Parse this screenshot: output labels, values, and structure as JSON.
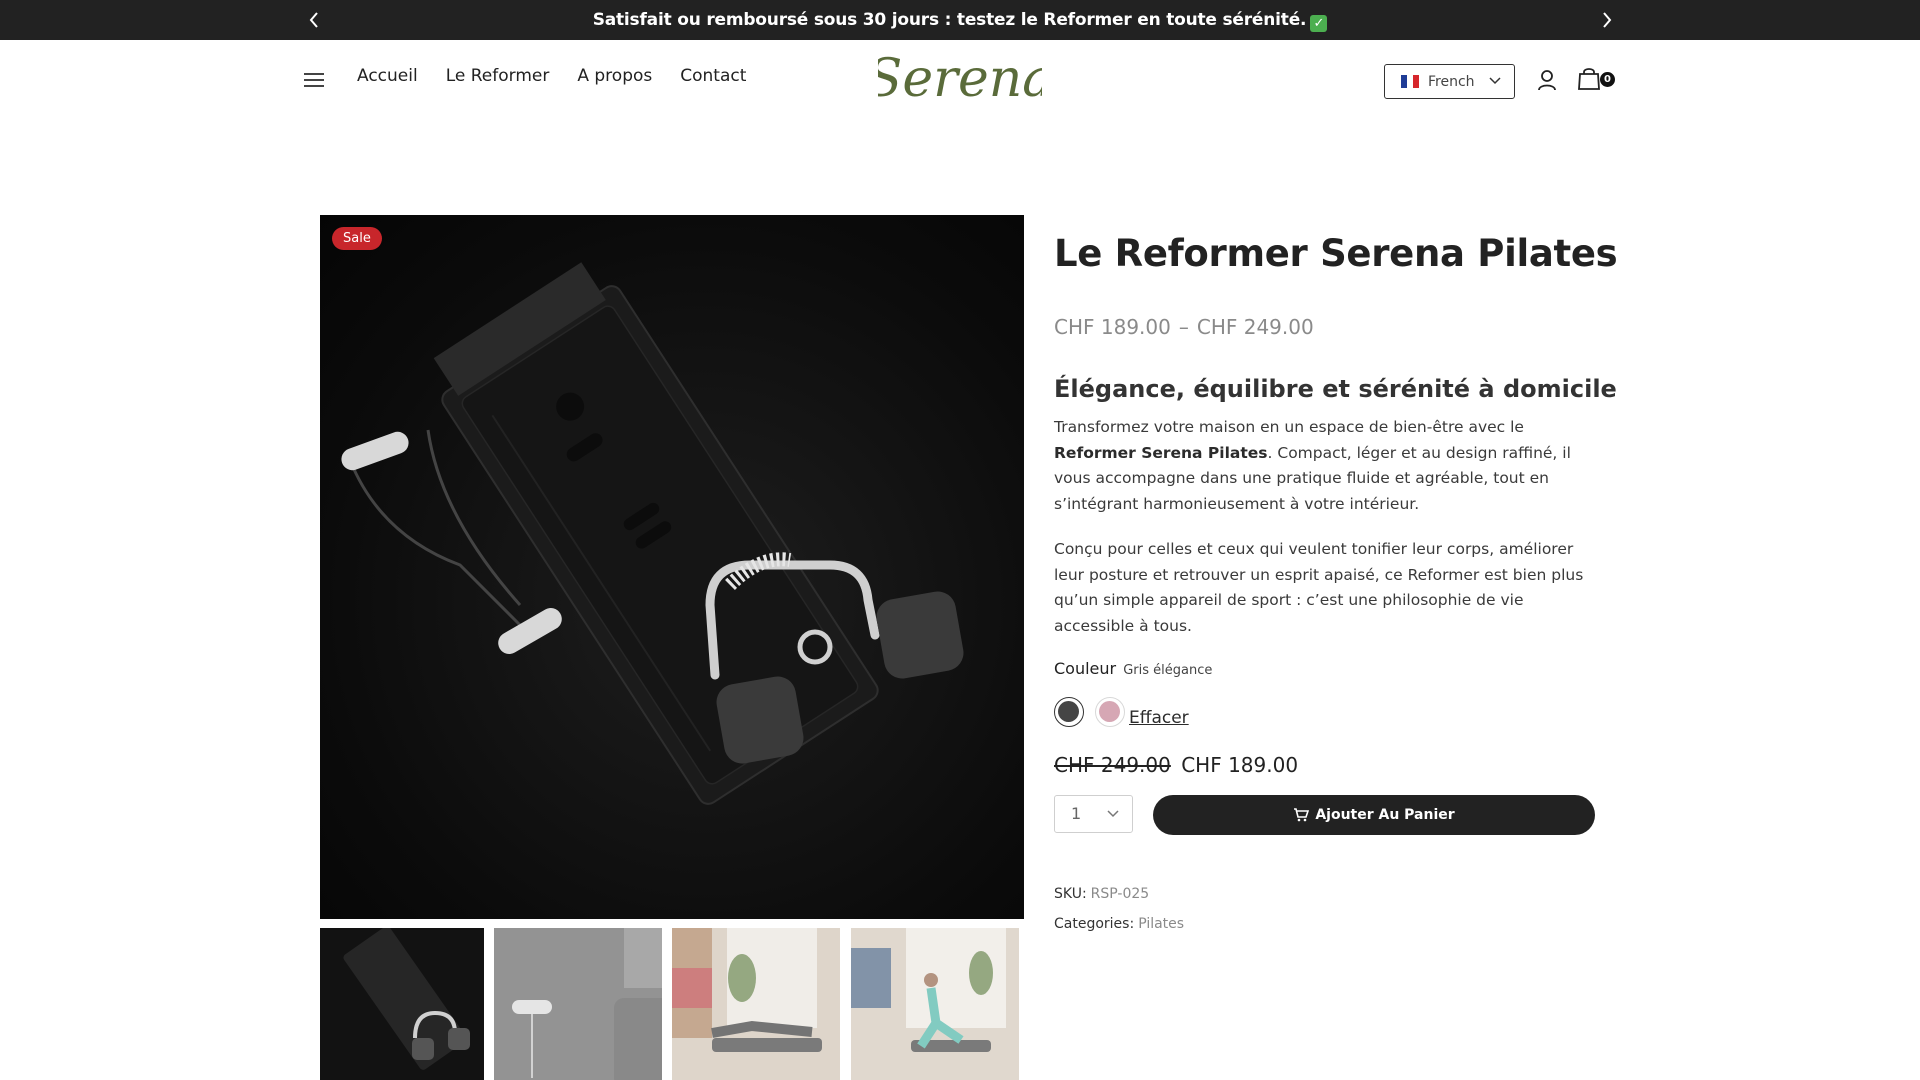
{
  "announcement": {
    "text": "Satisfait ou remboursé sous 30 jours : testez le Reformer en toute sérénité.",
    "prev_icon": "chevron-left-icon",
    "next_icon": "chevron-right-icon"
  },
  "header": {
    "nav": [
      "Accueil",
      "Le Reformer",
      "A propos",
      "Contact"
    ],
    "logo_text": "Serena",
    "language": "French",
    "cart_count": "0"
  },
  "gallery": {
    "badge": "Sale",
    "thumbnail_count": 4
  },
  "product": {
    "title": "Le Reformer Serena Pilates",
    "price_min": "CHF 189.00",
    "price_sep": "–",
    "price_max": "CHF 249.00",
    "subtitle": "Élégance, équilibre et sérénité à domicile",
    "desc1_pre": "Transformez votre maison en un espace de bien-être avec le ",
    "desc1_bold": "Reformer Serena Pilates",
    "desc1_post": ". Compact, léger et au design raffiné, il vous accompagne dans une pratique fluide et agréable, tout en s’intégrant harmonieusement à votre intérieur.",
    "desc2": "Conçu pour celles et ceux qui veulent tonifier leur corps, améliorer leur posture et retrouver un esprit apaisé, ce Reformer est bien plus qu’un simple appareil de sport : c’est une philosophie de vie accessible à tous.",
    "color_label": "Couleur",
    "color_value": "Gris élégance",
    "swatch_colors": [
      "#454545",
      "#d6a7b4"
    ],
    "clear_label": "Effacer",
    "old_price": "CHF 249.00",
    "new_price": "CHF 189.00",
    "quantity": "1",
    "add_to_cart": "Ajouter Au Panier",
    "sku_label": "SKU:",
    "sku_value": "RSP-025",
    "categories_label": "Categories:",
    "categories_value": "Pilates"
  },
  "colors": {
    "topbar": "#222222",
    "sale": "#c8262b",
    "logo": "#5a6b3a",
    "button": "#222222"
  }
}
